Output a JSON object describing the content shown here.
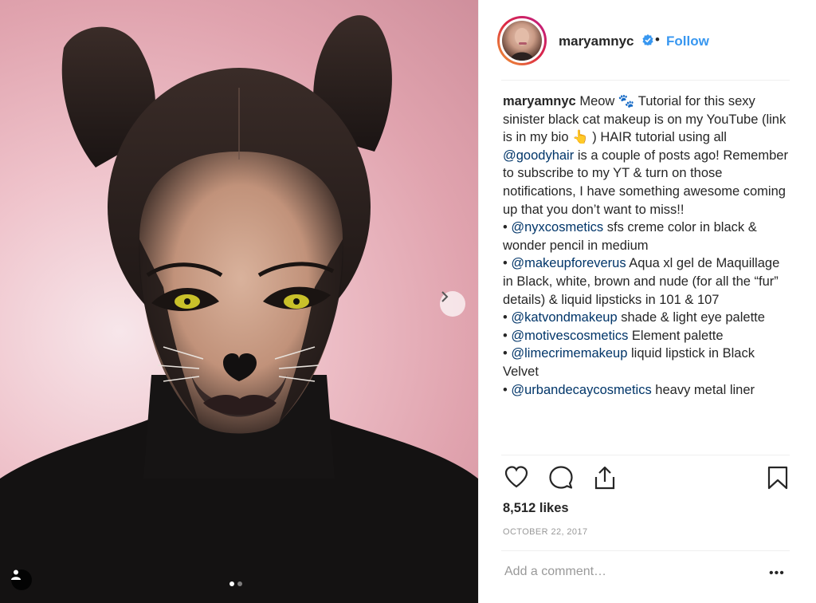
{
  "header": {
    "username": "maryamnyc",
    "bullet": "•",
    "follow_label": "Follow"
  },
  "caption": {
    "username": "maryamnyc",
    "lines": [
      [
        {
          "t": "Meow 🐾 Tutorial for this sexy sinister black cat makeup is on my YouTube (link is in my bio 👆 ) HAIR tutorial using all "
        },
        {
          "m": "@goodyhair"
        },
        {
          "t": " is a couple of posts ago! Remember to subscribe to my YT & turn on those notifications, I have something awesome coming up that you don’t want to miss!!"
        }
      ],
      [
        {
          "t": "• "
        },
        {
          "m": "@nyxcosmetics"
        },
        {
          "t": " sfs creme color in black & wonder pencil in medium"
        }
      ],
      [
        {
          "t": "• "
        },
        {
          "m": "@makeupforeverus"
        },
        {
          "t": " Aqua xl gel de Maquillage in Black, white, brown and nude (for all the “fur” details) & liquid lipsticks in 101 & 107"
        }
      ],
      [
        {
          "t": "• "
        },
        {
          "m": "@katvondmakeup"
        },
        {
          "t": " shade & light eye palette"
        }
      ],
      [
        {
          "t": "• "
        },
        {
          "m": "@motivescosmetics"
        },
        {
          "t": " Element palette"
        }
      ],
      [
        {
          "t": "• "
        },
        {
          "m": "@limecrimemakeup"
        },
        {
          "t": " liquid lipstick in Black Velvet"
        }
      ],
      [
        {
          "t": "• "
        },
        {
          "m": "@urbandecaycosmetics"
        },
        {
          "t": " heavy metal liner"
        }
      ]
    ]
  },
  "actions": {
    "icons": [
      "heart-icon",
      "comment-icon",
      "share-icon",
      "bookmark-icon"
    ]
  },
  "likes": "8,512 likes",
  "date": "OCTOBER 22, 2017",
  "comment": {
    "placeholder": "Add a comment…",
    "more_label": "•••"
  },
  "media": {
    "carousel_total": 2,
    "carousel_current": 1,
    "icons": [
      "user-tag-icon",
      "chevron-right-icon"
    ]
  },
  "colors": {
    "link": "#3897f0",
    "mention": "#003569",
    "text": "#262626",
    "muted": "#999999",
    "background_pink": "#efc3cb"
  }
}
